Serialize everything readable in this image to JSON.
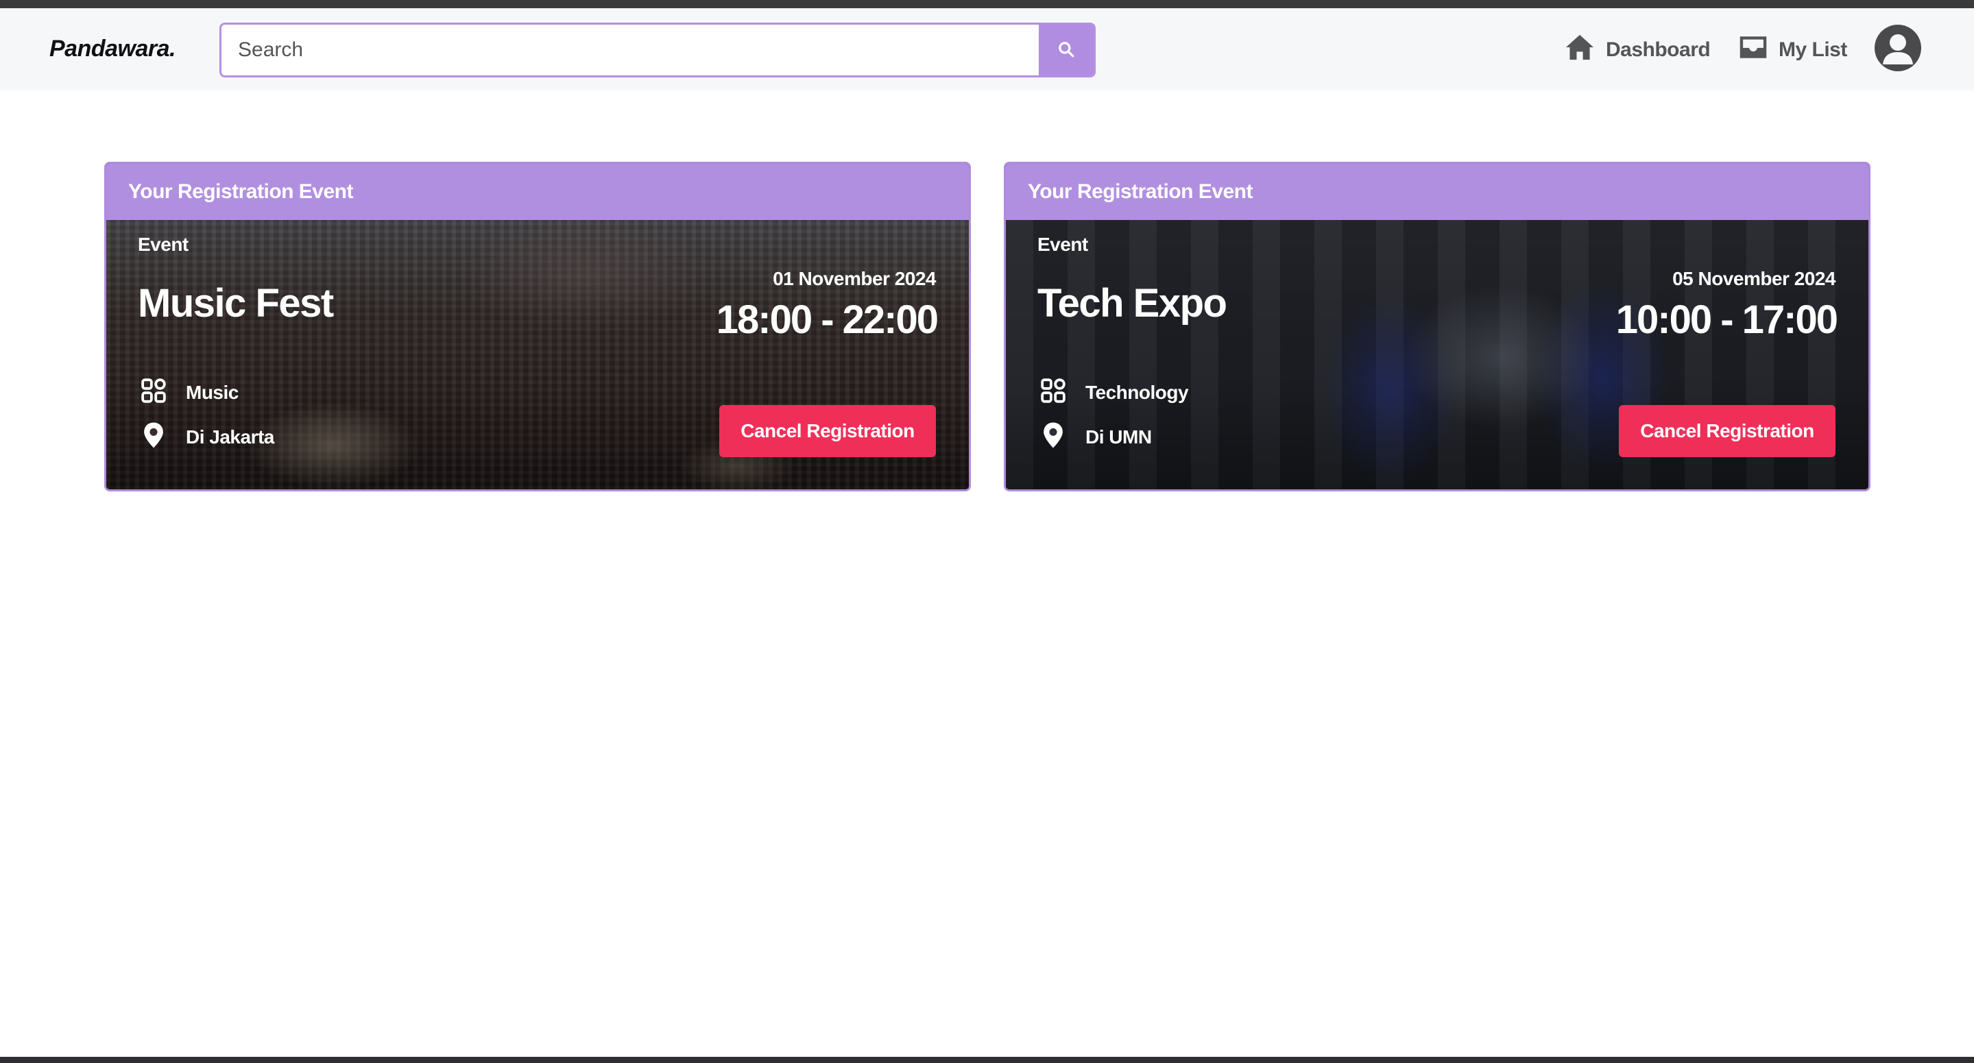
{
  "navbar": {
    "logo": "Pandawara.",
    "search": {
      "placeholder": "Search",
      "value": ""
    },
    "links": [
      {
        "label": "Dashboard",
        "icon": "home-icon"
      },
      {
        "label": "My List",
        "icon": "inbox-icon"
      }
    ],
    "avatar_icon": "user-avatar-icon"
  },
  "colors": {
    "accent": "#b18fe0",
    "danger": "#ef2f58",
    "navbar_bg": "#f6f7f9"
  },
  "cards": [
    {
      "header": "Your Registration Event",
      "label": "Event",
      "title": "Music Fest",
      "category": "Music",
      "location": "Di Jakarta",
      "date": "01 November 2024",
      "time": "18:00 - 22:00",
      "action": "Cancel Registration",
      "image": "music-festival-crowd"
    },
    {
      "header": "Your Registration Event",
      "label": "Event",
      "title": "Tech Expo",
      "category": "Technology",
      "location": "Di UMN",
      "date": "05 November 2024",
      "time": "10:00 - 17:00",
      "action": "Cancel Registration",
      "image": "tech-expo-satellite-exhibit"
    }
  ]
}
